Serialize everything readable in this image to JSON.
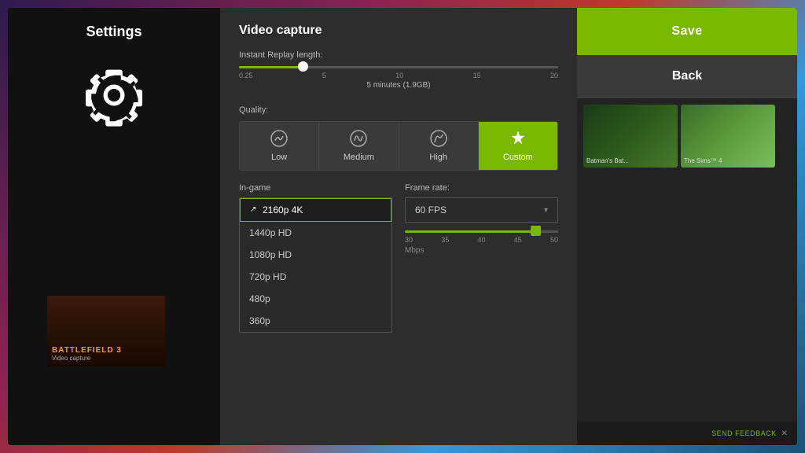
{
  "background": {
    "gradient": "purple-red-blue"
  },
  "settings_sidebar": {
    "title": "Settings",
    "icon": "gear"
  },
  "right_panel": {
    "save_button": "Save",
    "back_button": "Back",
    "thumbnails": [
      {
        "name": "Batman's Bat...",
        "color": "green-dark"
      },
      {
        "name": "The Sims™ 4",
        "color": "green-light"
      }
    ],
    "feedback": "SEND FEEDBACK"
  },
  "dialog": {
    "title": "Video capture",
    "instant_replay": {
      "label": "Instant Replay length:",
      "value": "5 minutes (1.9GB)",
      "min": "0.25",
      "max": "20",
      "ticks": [
        "0.25",
        "5",
        "10",
        "15",
        "20"
      ],
      "fill_percent": 20
    },
    "quality": {
      "label": "Quality:",
      "options": [
        {
          "id": "low",
          "label": "Low",
          "icon": "▼",
          "active": false
        },
        {
          "id": "medium",
          "label": "Medium",
          "icon": "◆",
          "active": false
        },
        {
          "id": "high",
          "label": "High",
          "icon": "▲",
          "active": false
        },
        {
          "id": "custom",
          "label": "Custom",
          "icon": "🔧",
          "active": true
        }
      ]
    },
    "in_game": {
      "label": "In-game",
      "resolutions": [
        {
          "label": "2160p 4K",
          "selected": true
        },
        {
          "label": "1440p HD",
          "selected": false
        },
        {
          "label": "1080p HD",
          "selected": false
        },
        {
          "label": "720p HD",
          "selected": false
        },
        {
          "label": "480p",
          "selected": false
        },
        {
          "label": "360p",
          "selected": false
        }
      ]
    },
    "frame_rate": {
      "label": "Frame rate:",
      "value": "60 FPS"
    },
    "bitrate": {
      "ticks": [
        "30",
        "35",
        "40",
        "45",
        "50"
      ],
      "unit": "Mbps",
      "fill_percent": 85
    }
  }
}
